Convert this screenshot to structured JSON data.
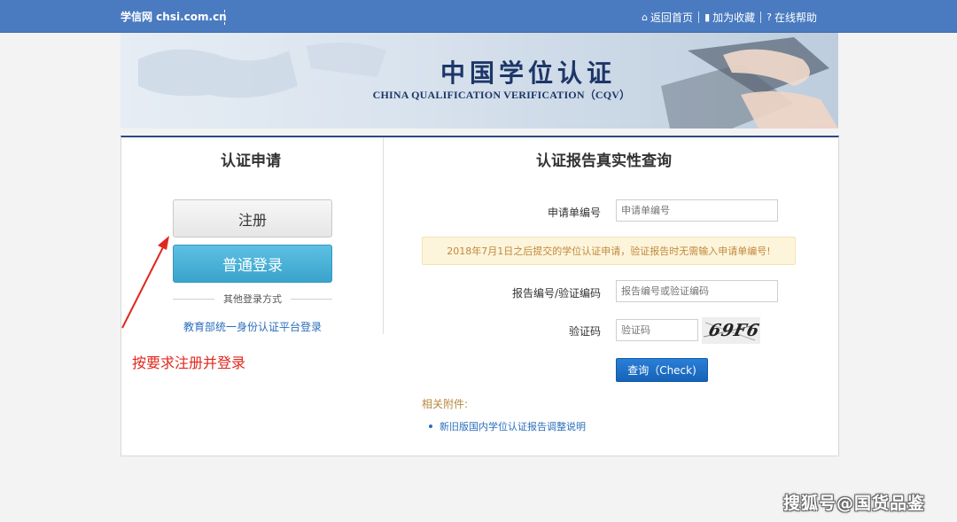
{
  "topbar": {
    "brand": "学信网 chsi.com.cn",
    "links": [
      {
        "icon": "home-icon",
        "label": "返回首页"
      },
      {
        "icon": "bookmark-icon",
        "label": "加为收藏"
      },
      {
        "icon": "help-icon",
        "label": "在线帮助"
      }
    ]
  },
  "banner": {
    "title_cn": "中国学位认证",
    "title_en": "CHINA QUALIFICATION VERIFICATION（CQV）"
  },
  "left": {
    "title": "认证申请",
    "register_label": "注册",
    "login_label": "普通登录",
    "other_login": "其他登录方式",
    "edu_link": "教育部统一身份认证平台登录"
  },
  "annotation": "按要求注册并登录",
  "right": {
    "title": "认证报告真实性查询",
    "application_no_label": "申请单编号",
    "application_no_placeholder": "申请单编号",
    "notice": "2018年7月1日之后提交的学位认证申请，验证报告时无需输入申请单编号!",
    "report_no_label": "报告编号/验证编码",
    "report_no_placeholder": "报告编号或验证编码",
    "captcha_label": "验证码",
    "captcha_placeholder": "验证码",
    "captcha_text": "69F6",
    "check_button": "查询（Check)",
    "attachments_title": "相关附件:",
    "attachments": [
      "新旧版国内学位认证报告调整说明"
    ]
  },
  "watermark": "搜狐号@国货品鉴",
  "colors": {
    "topbar": "#4a7bc0",
    "banner_title": "#1d3668",
    "login_button": "#3aa3cc",
    "check_button": "#1563b8",
    "annotation": "#e0281d",
    "link": "#2a6ebb",
    "notice_bg": "#fdf4dc"
  }
}
